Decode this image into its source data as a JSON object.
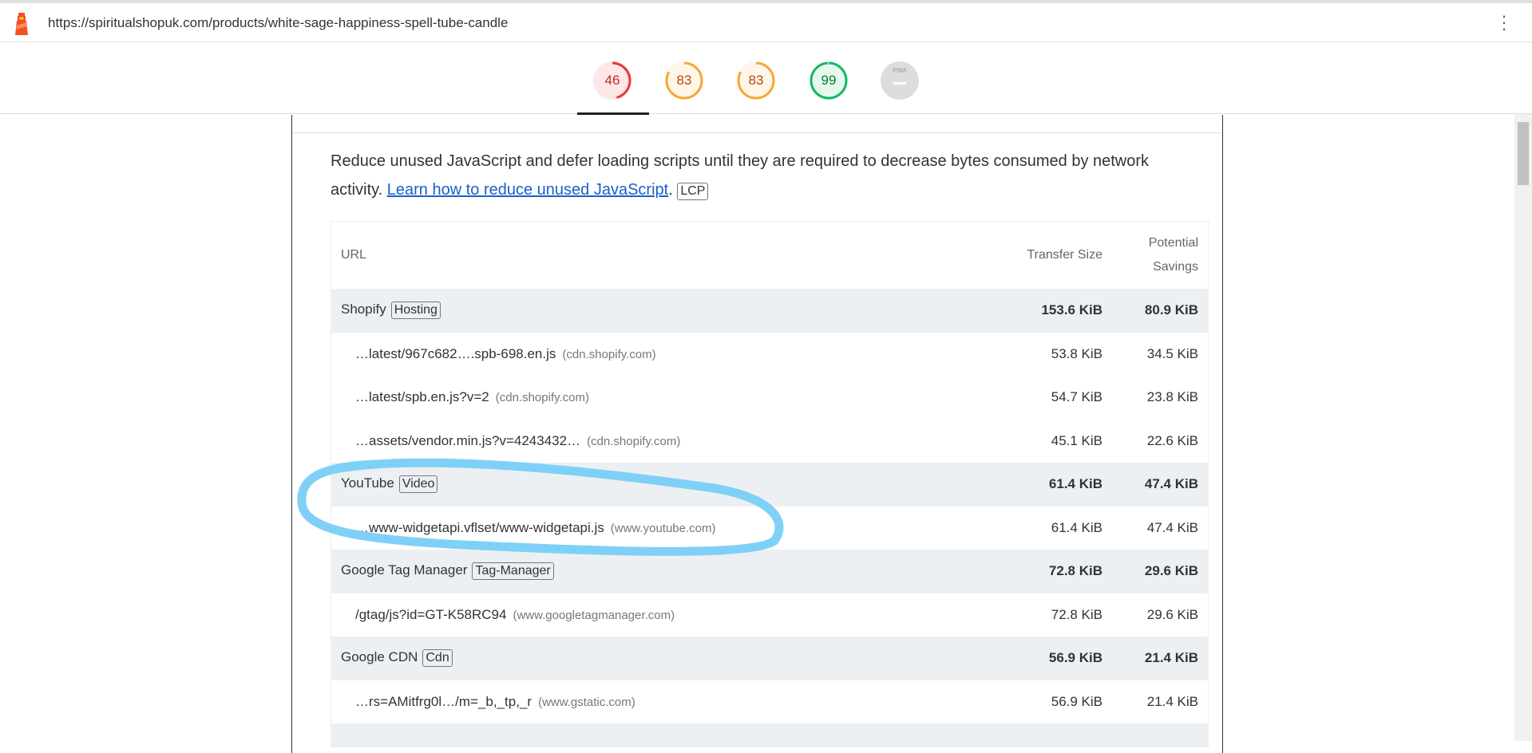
{
  "browser": {
    "url": "https://spiritualshopuk.com/products/white-sage-happiness-spell-tube-candle",
    "menu_icon": "kebab-menu-icon",
    "logo_icon": "lighthouse-icon"
  },
  "scores": [
    {
      "value": "46",
      "score": 46,
      "color": "#e53935",
      "bg": "#fde7e7",
      "text": "#c62828"
    },
    {
      "value": "83",
      "score": 83,
      "color": "#f4a83a",
      "bg": "#fff6ea",
      "text": "#b5480b"
    },
    {
      "value": "83",
      "score": 83,
      "color": "#f4a83a",
      "bg": "#fff6ea",
      "text": "#b5480b"
    },
    {
      "value": "99",
      "score": 99,
      "color": "#18b663",
      "bg": "#e6f8ee",
      "text": "#0a7a35"
    },
    {
      "value": "PWA",
      "score": null,
      "color": "#ddd",
      "bg": "#ddd",
      "text": "#999"
    }
  ],
  "audit": {
    "description": "Reduce unused JavaScript and defer loading scripts until they are required to decrease bytes consumed by network activity. ",
    "link": "Learn how to reduce unused JavaScript",
    "badge": "LCP",
    "columns": {
      "url": "URL",
      "transfer": "Transfer Size",
      "savings_1": "Potential",
      "savings_2": "Savings"
    },
    "rows": [
      {
        "type": "group",
        "url": "Shopify",
        "badge": "Hosting",
        "transfer": "153.6 KiB",
        "savings": "80.9 KiB"
      },
      {
        "type": "item",
        "url": "…latest/967c682….spb-698.en.js",
        "domain": "(cdn.shopify.com)",
        "transfer": "53.8 KiB",
        "savings": "34.5 KiB"
      },
      {
        "type": "item",
        "url": "…latest/spb.en.js?v=2",
        "domain": "(cdn.shopify.com)",
        "transfer": "54.7 KiB",
        "savings": "23.8 KiB"
      },
      {
        "type": "item",
        "url": "…assets/vendor.min.js?v=4243432…",
        "domain": "(cdn.shopify.com)",
        "transfer": "45.1 KiB",
        "savings": "22.6 KiB"
      },
      {
        "type": "group",
        "url": "YouTube",
        "badge": "Video",
        "transfer": "61.4 KiB",
        "savings": "47.4 KiB"
      },
      {
        "type": "item",
        "url": "…www-widgetapi.vflset/www-widgetapi.js",
        "domain": "(www.youtube.com)",
        "transfer": "61.4 KiB",
        "savings": "47.4 KiB"
      },
      {
        "type": "group",
        "url": "Google Tag Manager",
        "badge": "Tag-Manager",
        "transfer": "72.8 KiB",
        "savings": "29.6 KiB"
      },
      {
        "type": "item",
        "url": "/gtag/js?id=GT-K58RC94",
        "domain": "(www.googletagmanager.com)",
        "transfer": "72.8 KiB",
        "savings": "29.6 KiB"
      },
      {
        "type": "group",
        "url": "Google CDN",
        "badge": "Cdn",
        "transfer": "56.9 KiB",
        "savings": "21.4 KiB"
      },
      {
        "type": "item",
        "url": "…rs=AMitfrg0l…/m=_b,_tp,_r",
        "domain": "(www.gstatic.com)",
        "transfer": "56.9 KiB",
        "savings": "21.4 KiB"
      }
    ]
  },
  "annotation_color": "#7fd0f7"
}
